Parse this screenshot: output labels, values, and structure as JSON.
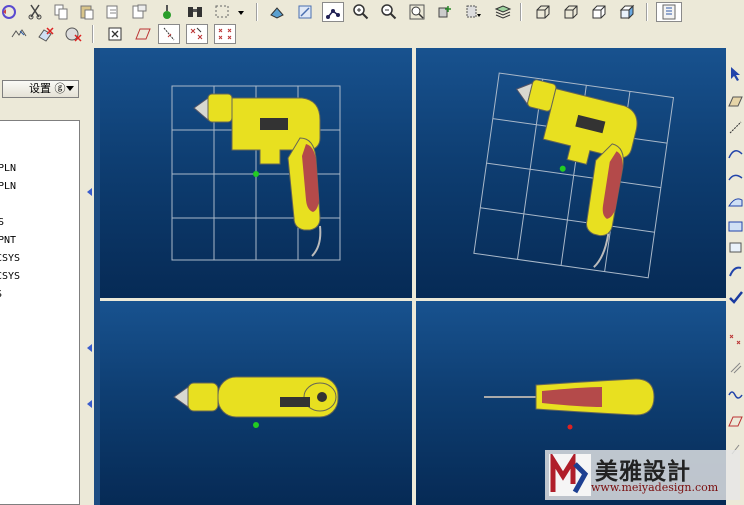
{
  "toolbar_top": {
    "icons": [
      "regenerate-icon",
      "cut-icon",
      "copy-icon",
      "paste-icon",
      "traffic-light-icon",
      "binoculars-icon",
      "select-box-icon",
      "orient-icon",
      "sketch-icon",
      "datum-axis-icon",
      "zoom-in-icon",
      "zoom-out-icon",
      "refit-icon",
      "spin-center-icon",
      "saved-views-icon",
      "layers-icon",
      "wireframe-icon",
      "hidden-line-icon",
      "no-hidden-icon",
      "shading-icon",
      "model-tree-icon"
    ]
  },
  "toolbar_second": {
    "icons": [
      "datum-display-icon",
      "erase-icon",
      "remove-icon",
      "close-window-icon",
      "datum-planes-icon",
      "datum-axes-icon",
      "datum-points-icon",
      "coordinate-systems-icon"
    ]
  },
  "left_panel": {
    "settings_label": "设置 ⓖ",
    "tree_items": [
      "PLN",
      "PLN",
      "S",
      "PNT",
      "CSYS",
      "CSYS",
      "S"
    ]
  },
  "watermark": {
    "title": "美雅設計",
    "url": "www.meiyadesign.com"
  },
  "colors": {
    "viewport_top": "#18528f",
    "viewport_bottom": "#062a55",
    "model_yellow": "#e8e020",
    "grip_red": "#b44a4a",
    "selection_blue": "#3a5ccc"
  }
}
